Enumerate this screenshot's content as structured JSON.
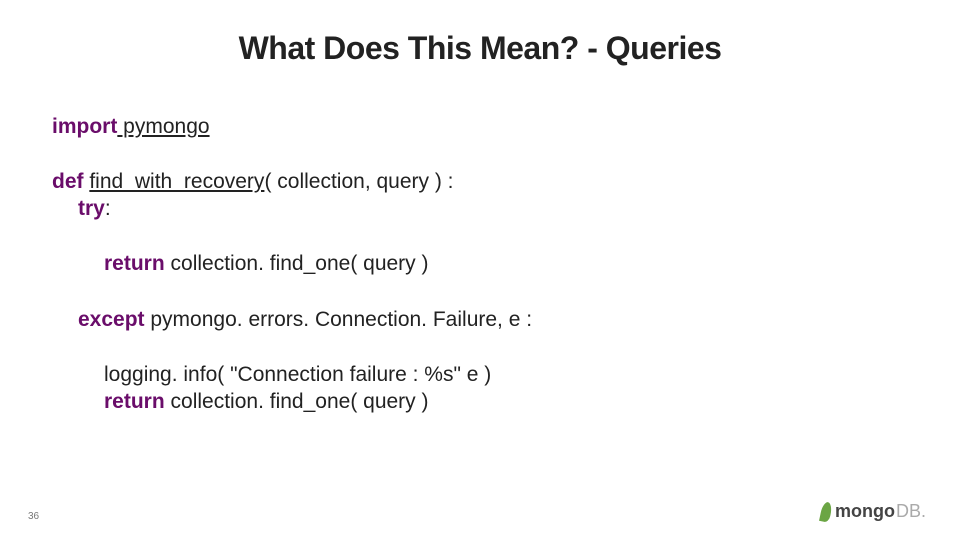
{
  "slide": {
    "title": "What Does This Mean? - Queries",
    "page_number": "36"
  },
  "code": {
    "line1_kw": "import",
    "line1_rest": " pymongo",
    "line2_kw": "def",
    "line2_sp": " ",
    "line2_name": "find_with_recovery",
    "line2_rest": "( collection, query ) :",
    "line3_kw": "try",
    "line3_rest": ":",
    "line4_kw": "return",
    "line4_rest": " collection. find_one( query )",
    "line5_kw": "except",
    "line5_rest": " pymongo. errors. Connection. Failure, e :",
    "line6": "logging. info( \"Connection failure : %s\" e )",
    "line7_kw": "return",
    "line7_rest": " collection. find_one( query )"
  },
  "logo": {
    "part1": "mongo",
    "part2": "DB."
  }
}
